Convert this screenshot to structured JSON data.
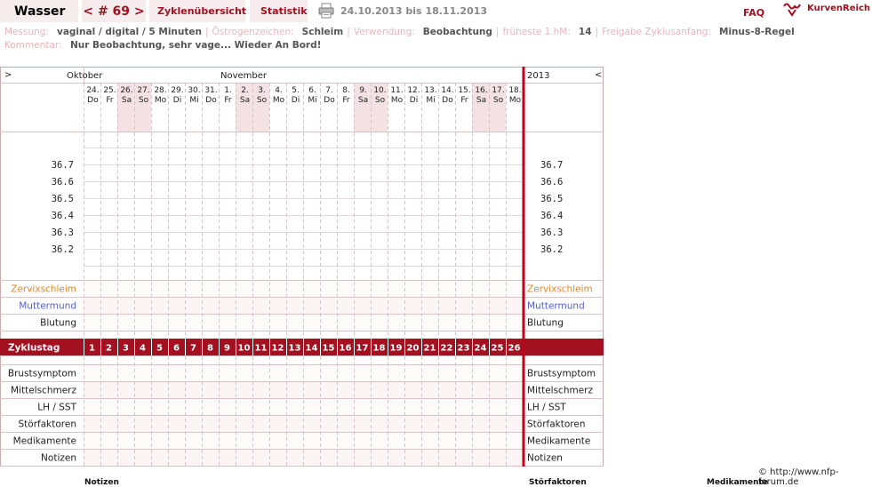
{
  "header": {
    "title": "Wasser",
    "cycle_nav": "< # 69 >",
    "tab_overview": "Zyklenübersicht",
    "tab_stats": "Statistik",
    "date_range": "24.10.2013 bis 18.11.2013",
    "faq": "FAQ",
    "logo_text": "KurvenReich"
  },
  "info": {
    "row1": [
      {
        "label": "Messung:",
        "value": "vaginal / digital / 5 Minuten"
      },
      {
        "label": "Östrogenzeichen:",
        "value": "Schleim"
      },
      {
        "label": "Verwendung:",
        "value": "Beobachtung"
      },
      {
        "label": "früheste 1.hM:",
        "value": "14"
      },
      {
        "label": "Freigabe Zyklusanfang:",
        "value": "Minus-8-Regel"
      }
    ],
    "comment_label": "Kommentar:",
    "comment_value": "Nur Beobachtung, sehr vage... Wieder An Bord!"
  },
  "chart": {
    "nav_left": ">",
    "nav_right": "<",
    "year": "2013",
    "months": [
      {
        "name": "Oktober",
        "day_index": 0
      },
      {
        "name": "November",
        "day_index": 8
      }
    ],
    "days": [
      {
        "d": "24.",
        "w": "Do",
        "we": false
      },
      {
        "d": "25.",
        "w": "Fr",
        "we": false
      },
      {
        "d": "26.",
        "w": "Sa",
        "we": true
      },
      {
        "d": "27.",
        "w": "So",
        "we": true
      },
      {
        "d": "28.",
        "w": "Mo",
        "we": false
      },
      {
        "d": "29.",
        "w": "Di",
        "we": false
      },
      {
        "d": "30.",
        "w": "Mi",
        "we": false
      },
      {
        "d": "31.",
        "w": "Do",
        "we": false
      },
      {
        "d": "1.",
        "w": "Fr",
        "we": false
      },
      {
        "d": "2.",
        "w": "Sa",
        "we": true
      },
      {
        "d": "3.",
        "w": "So",
        "we": true
      },
      {
        "d": "4.",
        "w": "Mo",
        "we": false
      },
      {
        "d": "5.",
        "w": "Di",
        "we": false
      },
      {
        "d": "6.",
        "w": "Mi",
        "we": false
      },
      {
        "d": "7.",
        "w": "Do",
        "we": false
      },
      {
        "d": "8.",
        "w": "Fr",
        "we": false
      },
      {
        "d": "9.",
        "w": "Sa",
        "we": true
      },
      {
        "d": "10.",
        "w": "So",
        "we": true
      },
      {
        "d": "11.",
        "w": "Mo",
        "we": false
      },
      {
        "d": "12.",
        "w": "Di",
        "we": false
      },
      {
        "d": "13.",
        "w": "Mi",
        "we": false
      },
      {
        "d": "14.",
        "w": "Do",
        "we": false
      },
      {
        "d": "15.",
        "w": "Fr",
        "we": false
      },
      {
        "d": "16.",
        "w": "Sa",
        "we": true
      },
      {
        "d": "17.",
        "w": "So",
        "we": true
      },
      {
        "d": "18.",
        "w": "Mo",
        "we": false
      }
    ],
    "temps": [
      "36.7",
      "36.6",
      "36.5",
      "36.4",
      "36.3",
      "36.2"
    ],
    "rows_top": [
      {
        "label": "Zervixschleim",
        "color": "#e8861e"
      },
      {
        "label": "Muttermund",
        "color": "#5563c9"
      },
      {
        "label": "Blutung",
        "color": "#222222"
      }
    ],
    "cycle_label": "Zyklustag",
    "cycle_days": [
      "1",
      "2",
      "3",
      "4",
      "5",
      "6",
      "7",
      "8",
      "9",
      "10",
      "11",
      "12",
      "13",
      "14",
      "15",
      "16",
      "17",
      "18",
      "19",
      "20",
      "21",
      "22",
      "23",
      "24",
      "25",
      "26"
    ],
    "rows_bottom": [
      {
        "label": "Brustsymptom"
      },
      {
        "label": "Mittelschmerz"
      },
      {
        "label": "LH / SST"
      },
      {
        "label": "Störfaktoren"
      },
      {
        "label": "Medikamente"
      },
      {
        "label": "Notizen"
      }
    ],
    "colors": {
      "accent": "#a3101f",
      "weekend": "#f3e1e3",
      "grid": "#d8c3c6",
      "border": "#c9a9ad",
      "redline": "#c0001a"
    }
  },
  "footer": {
    "copyright": "© http://www.nfp-forum.de",
    "labels": [
      "Notizen",
      "Störfaktoren",
      "Medikamente"
    ]
  }
}
